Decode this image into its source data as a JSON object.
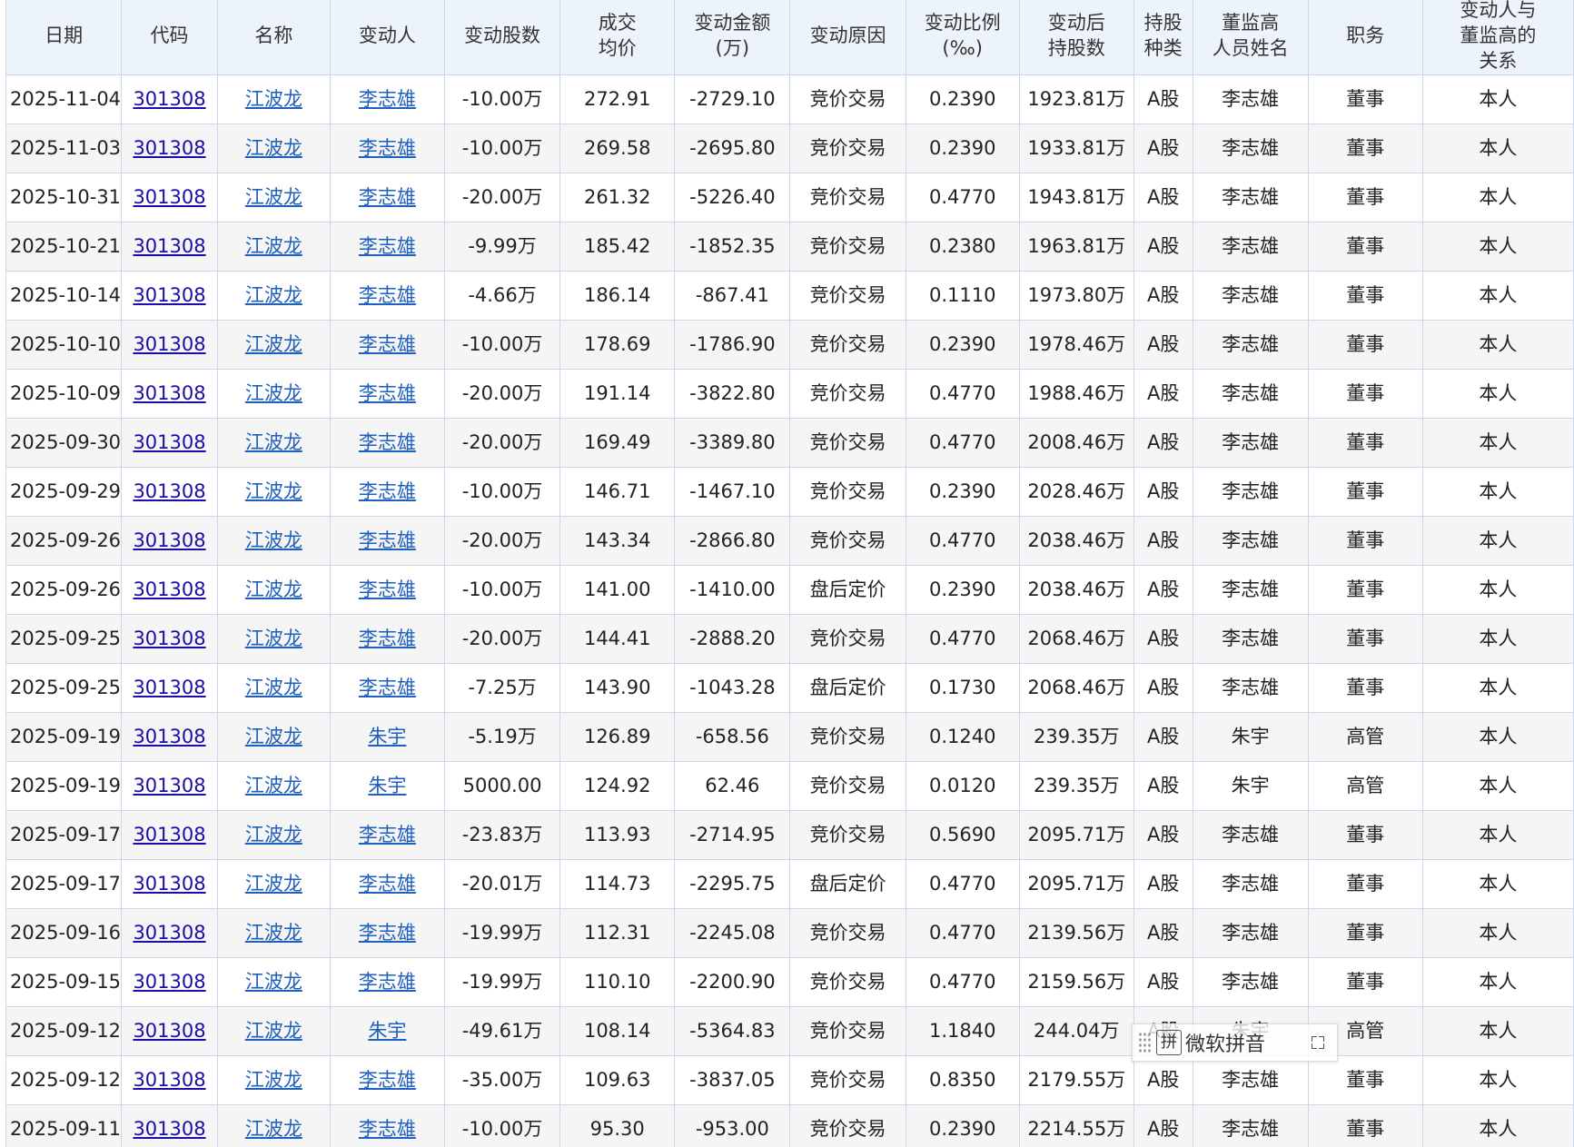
{
  "table": {
    "headers": [
      "日期",
      "代码",
      "名称",
      "变动人",
      "变动股数",
      "成交\n均价",
      "变动金额\n(万)",
      "变动原因",
      "变动比例\n(‰)",
      "变动后\n持股数",
      "持股\n种类",
      "董监高\n人员姓名",
      "职务",
      "变动人与\n董监高的\n关系"
    ],
    "rows": [
      [
        "2025-11-04",
        "301308",
        "江波龙",
        "李志雄",
        "-10.00万",
        "272.91",
        "-2729.10",
        "竞价交易",
        "0.2390",
        "1923.81万",
        "A股",
        "李志雄",
        "董事",
        "本人"
      ],
      [
        "2025-11-03",
        "301308",
        "江波龙",
        "李志雄",
        "-10.00万",
        "269.58",
        "-2695.80",
        "竞价交易",
        "0.2390",
        "1933.81万",
        "A股",
        "李志雄",
        "董事",
        "本人"
      ],
      [
        "2025-10-31",
        "301308",
        "江波龙",
        "李志雄",
        "-20.00万",
        "261.32",
        "-5226.40",
        "竞价交易",
        "0.4770",
        "1943.81万",
        "A股",
        "李志雄",
        "董事",
        "本人"
      ],
      [
        "2025-10-21",
        "301308",
        "江波龙",
        "李志雄",
        "-9.99万",
        "185.42",
        "-1852.35",
        "竞价交易",
        "0.2380",
        "1963.81万",
        "A股",
        "李志雄",
        "董事",
        "本人"
      ],
      [
        "2025-10-14",
        "301308",
        "江波龙",
        "李志雄",
        "-4.66万",
        "186.14",
        "-867.41",
        "竞价交易",
        "0.1110",
        "1973.80万",
        "A股",
        "李志雄",
        "董事",
        "本人"
      ],
      [
        "2025-10-10",
        "301308",
        "江波龙",
        "李志雄",
        "-10.00万",
        "178.69",
        "-1786.90",
        "竞价交易",
        "0.2390",
        "1978.46万",
        "A股",
        "李志雄",
        "董事",
        "本人"
      ],
      [
        "2025-10-09",
        "301308",
        "江波龙",
        "李志雄",
        "-20.00万",
        "191.14",
        "-3822.80",
        "竞价交易",
        "0.4770",
        "1988.46万",
        "A股",
        "李志雄",
        "董事",
        "本人"
      ],
      [
        "2025-09-30",
        "301308",
        "江波龙",
        "李志雄",
        "-20.00万",
        "169.49",
        "-3389.80",
        "竞价交易",
        "0.4770",
        "2008.46万",
        "A股",
        "李志雄",
        "董事",
        "本人"
      ],
      [
        "2025-09-29",
        "301308",
        "江波龙",
        "李志雄",
        "-10.00万",
        "146.71",
        "-1467.10",
        "竞价交易",
        "0.2390",
        "2028.46万",
        "A股",
        "李志雄",
        "董事",
        "本人"
      ],
      [
        "2025-09-26",
        "301308",
        "江波龙",
        "李志雄",
        "-20.00万",
        "143.34",
        "-2866.80",
        "竞价交易",
        "0.4770",
        "2038.46万",
        "A股",
        "李志雄",
        "董事",
        "本人"
      ],
      [
        "2025-09-26",
        "301308",
        "江波龙",
        "李志雄",
        "-10.00万",
        "141.00",
        "-1410.00",
        "盘后定价",
        "0.2390",
        "2038.46万",
        "A股",
        "李志雄",
        "董事",
        "本人"
      ],
      [
        "2025-09-25",
        "301308",
        "江波龙",
        "李志雄",
        "-20.00万",
        "144.41",
        "-2888.20",
        "竞价交易",
        "0.4770",
        "2068.46万",
        "A股",
        "李志雄",
        "董事",
        "本人"
      ],
      [
        "2025-09-25",
        "301308",
        "江波龙",
        "李志雄",
        "-7.25万",
        "143.90",
        "-1043.28",
        "盘后定价",
        "0.1730",
        "2068.46万",
        "A股",
        "李志雄",
        "董事",
        "本人"
      ],
      [
        "2025-09-19",
        "301308",
        "江波龙",
        "朱宇",
        "-5.19万",
        "126.89",
        "-658.56",
        "竞价交易",
        "0.1240",
        "239.35万",
        "A股",
        "朱宇",
        "高管",
        "本人"
      ],
      [
        "2025-09-19",
        "301308",
        "江波龙",
        "朱宇",
        "5000.00",
        "124.92",
        "62.46",
        "竞价交易",
        "0.0120",
        "239.35万",
        "A股",
        "朱宇",
        "高管",
        "本人"
      ],
      [
        "2025-09-17",
        "301308",
        "江波龙",
        "李志雄",
        "-23.83万",
        "113.93",
        "-2714.95",
        "竞价交易",
        "0.5690",
        "2095.71万",
        "A股",
        "李志雄",
        "董事",
        "本人"
      ],
      [
        "2025-09-17",
        "301308",
        "江波龙",
        "李志雄",
        "-20.01万",
        "114.73",
        "-2295.75",
        "盘后定价",
        "0.4770",
        "2095.71万",
        "A股",
        "李志雄",
        "董事",
        "本人"
      ],
      [
        "2025-09-16",
        "301308",
        "江波龙",
        "李志雄",
        "-19.99万",
        "112.31",
        "-2245.08",
        "竞价交易",
        "0.4770",
        "2139.56万",
        "A股",
        "李志雄",
        "董事",
        "本人"
      ],
      [
        "2025-09-15",
        "301308",
        "江波龙",
        "李志雄",
        "-19.99万",
        "110.10",
        "-2200.90",
        "竞价交易",
        "0.4770",
        "2159.56万",
        "A股",
        "李志雄",
        "董事",
        "本人"
      ],
      [
        "2025-09-12",
        "301308",
        "江波龙",
        "朱宇",
        "-49.61万",
        "108.14",
        "-5364.83",
        "竞价交易",
        "1.1840",
        "244.04万",
        "A股",
        "朱宇",
        "高管",
        "本人"
      ],
      [
        "2025-09-12",
        "301308",
        "江波龙",
        "李志雄",
        "-35.00万",
        "109.63",
        "-3837.05",
        "竞价交易",
        "0.8350",
        "2179.55万",
        "A股",
        "李志雄",
        "董事",
        "本人"
      ],
      [
        "2025-09-11",
        "301308",
        "江波龙",
        "李志雄",
        "-10.00万",
        "95.30",
        "-953.00",
        "竞价交易",
        "0.2390",
        "2214.55万",
        "A股",
        "李志雄",
        "董事",
        "本人"
      ]
    ]
  },
  "ime_toolbar": {
    "logo": "拼",
    "name": "微软拼音"
  },
  "colors": {
    "header_bg": "#edf3fb",
    "border": "#c8d8ea",
    "link_code": "#1a0dab",
    "link_blue": "#1f5fbf",
    "stripe": "#f5f5f5"
  }
}
